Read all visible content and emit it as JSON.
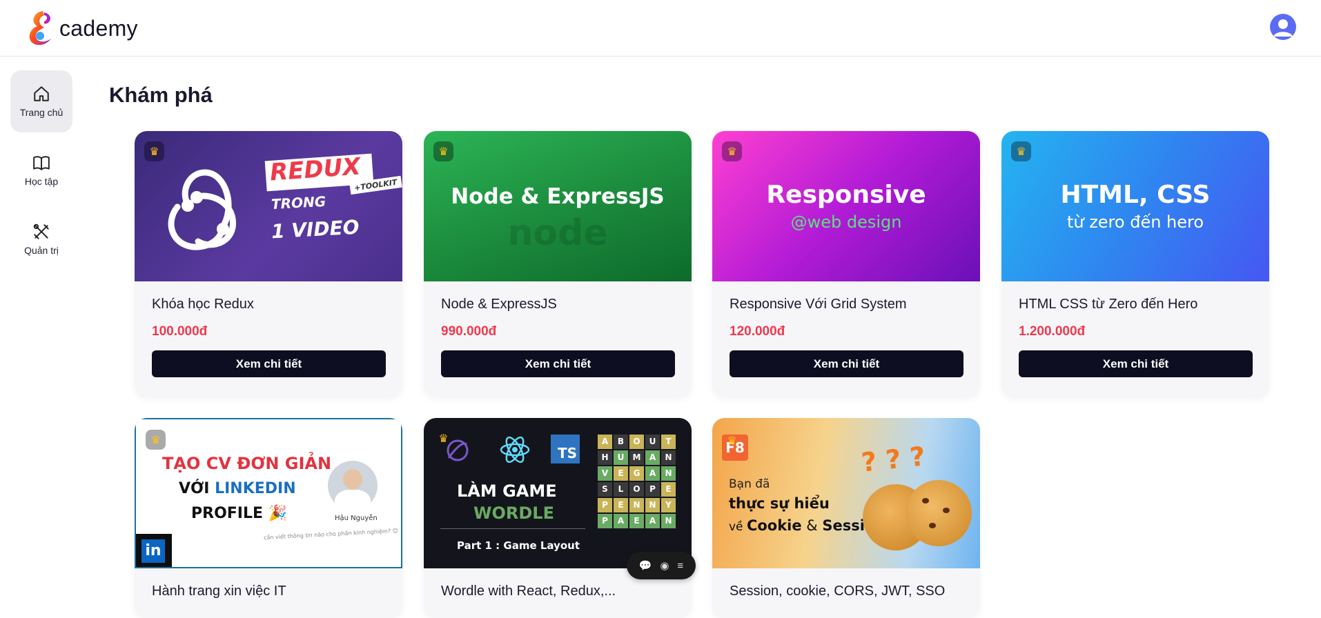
{
  "header": {
    "logo_text": "cademy"
  },
  "sidebar": {
    "items": [
      {
        "label": "Trang chủ",
        "icon": "home-icon",
        "active": true
      },
      {
        "label": "Học tập",
        "icon": "book-icon",
        "active": false
      },
      {
        "label": "Quản trị",
        "icon": "tools-icon",
        "active": false
      }
    ]
  },
  "main": {
    "title": "Khám phá",
    "button_label": "Xem chi tiết",
    "courses": [
      {
        "title": "Khóa học Redux",
        "price": "100.000đ",
        "thumb": {
          "line1": "REDUX",
          "line2": "TRONG",
          "line3": "1 VIDEO",
          "tag": "+TOOLKIT"
        }
      },
      {
        "title": "Node & ExpressJS",
        "price": "990.000đ",
        "thumb": {
          "line1": "Node & ExpressJS",
          "watermark": "node"
        }
      },
      {
        "title": "Responsive Với Grid System",
        "price": "120.000đ",
        "thumb": {
          "line1": "Responsive",
          "line2": "@web design"
        }
      },
      {
        "title": "HTML CSS từ Zero đến Hero",
        "price": "1.200.000đ",
        "thumb": {
          "line1": "HTML, CSS",
          "line2": "từ zero đến hero"
        }
      },
      {
        "title": "Hành trang xin việc IT",
        "thumb": {
          "line1": "TẠO CV ĐƠN GIẢN",
          "line2a": "VỚI ",
          "line2b": "LINKEDIN",
          "line3": "PROFILE 🎉",
          "person": "Hậu Nguyễn",
          "footnote": "cần viết thông tin nào cho phần kinh nghiệm? 😊",
          "badge": "in"
        }
      },
      {
        "title": "Wordle with React, Redux,...",
        "thumb": {
          "line1": "LÀM GAME",
          "line2": "WORDLE",
          "line3": "Part 1 : Game Layout",
          "ts": "TS",
          "grid": [
            "ABOUT",
            "HUMAN",
            "VEGAN",
            "SLOPE",
            "PENNY",
            "PAEAN"
          ]
        }
      },
      {
        "title": "Session, cookie, CORS, JWT, SSO",
        "thumb": {
          "line1": "Bạn đã",
          "line2": "thực sự hiểu",
          "line3a": "về ",
          "line3b": "Cookie",
          "line3c": " & ",
          "line3d": "Session",
          "badge": "F8",
          "marks": "? ? ?"
        }
      }
    ]
  },
  "tools": {
    "chat_icon": "chat-icon",
    "eye_icon": "eye-icon",
    "menu_icon": "menu-icon"
  }
}
